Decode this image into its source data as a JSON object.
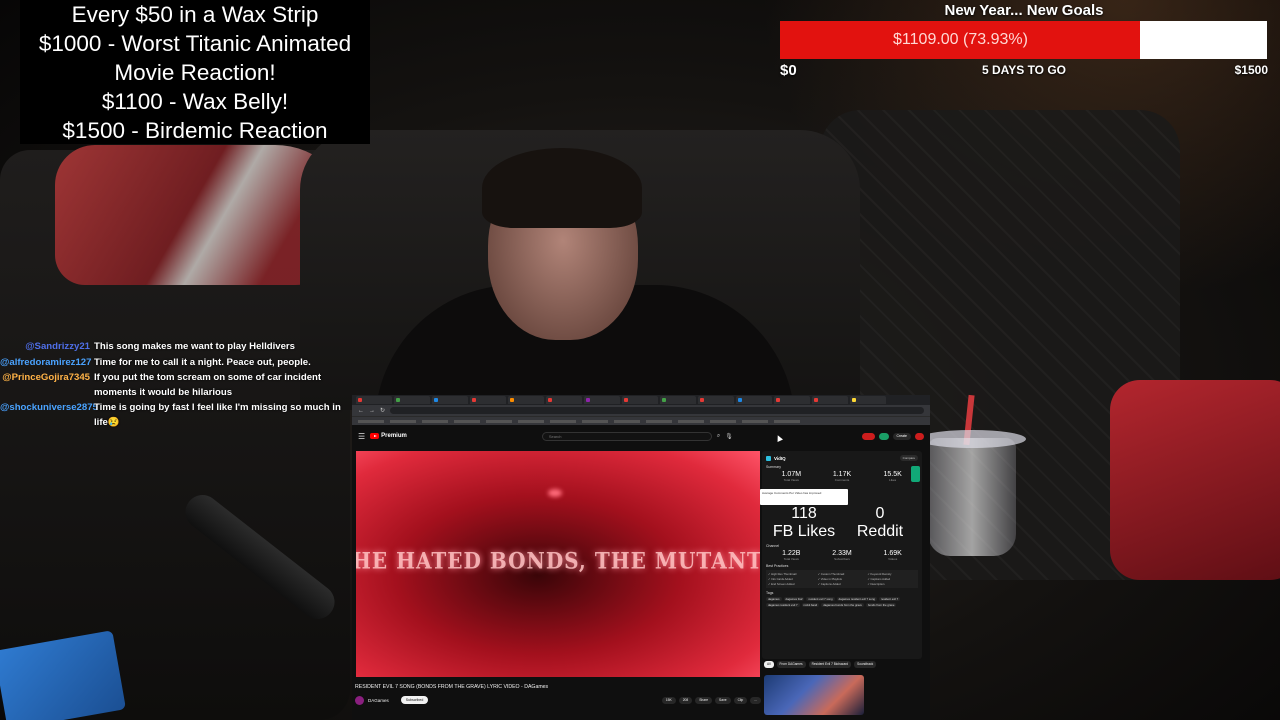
{
  "goals": {
    "lines": [
      "Every $50 in a Wax Strip",
      "$1000 - Worst Titanic Animated",
      "Movie Reaction!",
      "$1100 - Wax Belly!",
      "$1500 - Birdemic Reaction"
    ]
  },
  "donation_goal": {
    "title": "New Year... New Goals",
    "amount_label": "$1109.00 (73.93%)",
    "progress_percent": 73.93,
    "min_label": "$0",
    "days_label": "5 DAYS TO GO",
    "max_label": "$1500",
    "colors": {
      "fill": "#e2120f",
      "track": "#ffffff"
    }
  },
  "chat": [
    {
      "user": "@Sandrizzy21",
      "color": "#4f6fe8",
      "text": "This song makes me want to play Helldivers"
    },
    {
      "user": "@alfredoramirez127",
      "color": "#4aa3ff",
      "text": "Time for me to call it a night. Peace out, people."
    },
    {
      "user": "@PrinceGojira7345",
      "color": "#ffb347",
      "text": "If you put the tom scream on some of car incident moments it would be hilarious"
    },
    {
      "user": "@shockuniverse2875",
      "color": "#4aa3ff",
      "text": "Time is going by fast I feel like I'm missing so much in life😢"
    }
  ],
  "browser": {
    "youtube": {
      "logo_text": "Premium",
      "search_placeholder": "Search",
      "video_lyric": "HE HATED BONDS, THE MUTANT'S EYE",
      "video_title": "RESIDENT EVIL 7 SONG (BONDS FROM THE GRAVE) LYRIC VIDEO - DAGames",
      "channel_name": "DAGames",
      "subscribe_label": "Subscribed",
      "actions": [
        "15K",
        "208",
        "Share",
        "Save",
        "Clip",
        "..."
      ],
      "chips": [
        "All",
        "From DAGames",
        "Resident Evil 7 Biohazard",
        "Soundtrack"
      ],
      "create_label": "Create"
    },
    "vidiq": {
      "name": "VidIQ",
      "compare_label": "Compare",
      "summary_label": "Summary",
      "stats": [
        {
          "value": "1.07M",
          "label": "Total Views"
        },
        {
          "value": "1.17K",
          "label": "Comments"
        },
        {
          "value": "15.5K",
          "label": "Likes"
        }
      ],
      "social_label": "Social",
      "social": [
        {
          "value": "118",
          "label": "FB Likes"
        },
        {
          "value": "0",
          "label": "Reddit"
        }
      ],
      "channel_label": "Channel",
      "channel": [
        {
          "value": "1.22B",
          "label": "Total Views"
        },
        {
          "value": "2.33M",
          "label": "Subscribers"
        },
        {
          "value": "1.69K",
          "label": "Videos"
        }
      ],
      "best_practices_label": "Best Practices",
      "best_practices": [
        "High Res Thumbnail",
        "Custom Thumbnail",
        "Keyword Density",
        "Info Cards Added",
        "Video in Playlists",
        "Captions Added",
        "End Screen Added",
        "Captions Added",
        "Description"
      ],
      "tags_label": "Tags",
      "tags": [
        "dagames",
        "dagames fnaf",
        "resident evil 7 song",
        "dagames resident evil 7 song",
        "resident evil 7",
        "dagames resident evil 7",
        "rockit band",
        "dagames bonds from the grave",
        "bonds from the grave"
      ],
      "tooltip": "Average Comments Per Video has improved"
    }
  }
}
